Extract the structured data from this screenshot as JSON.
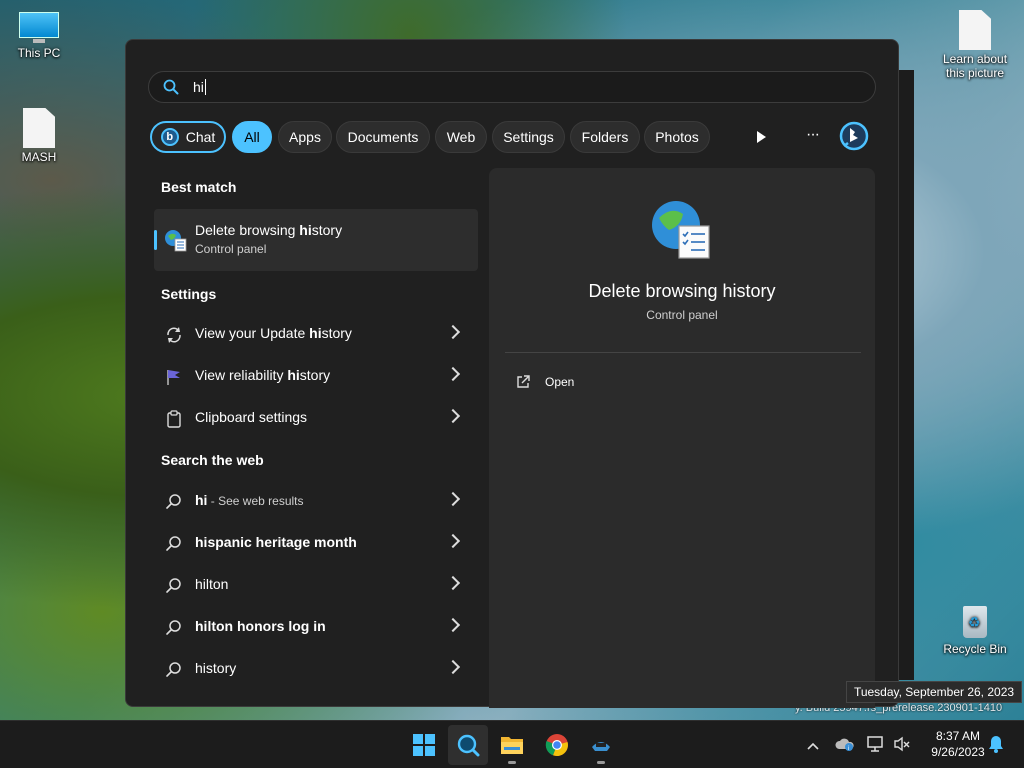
{
  "desktop": {
    "icons": [
      {
        "label": "This PC"
      },
      {
        "label": "MASH"
      },
      {
        "label": "Learn about this picture"
      },
      {
        "label": "Recycle Bin"
      }
    ],
    "build_text": "y. Build 25947.rs_prerelease.230901-1410"
  },
  "search": {
    "query": "hi",
    "filters": {
      "chat": "Chat",
      "all": "All",
      "apps": "Apps",
      "documents": "Documents",
      "web": "Web",
      "settings": "Settings",
      "folders": "Folders",
      "photos": "Photos"
    },
    "more_label": "···"
  },
  "results": {
    "best_match_title": "Best match",
    "best_match": {
      "pre": "Delete browsing ",
      "bold": "hi",
      "post": "story",
      "sub": "Control panel"
    },
    "settings_title": "Settings",
    "settings_items": [
      {
        "pre": "View your Update ",
        "bold": "hi",
        "post": "story"
      },
      {
        "pre": "View reliability ",
        "bold": "hi",
        "post": "story"
      },
      {
        "pre": "Clipboard settings",
        "bold": "",
        "post": ""
      }
    ],
    "web_title": "Search the web",
    "web_items": [
      {
        "bold": "hi",
        "rest": "",
        "sub": " - See web results"
      },
      {
        "bold": "",
        "rest": "hispanic heritage month",
        "sub": ""
      },
      {
        "bold": "",
        "rest": "hilton",
        "sub": ""
      },
      {
        "bold": "",
        "rest": "hilton honors log in",
        "sub": ""
      },
      {
        "bold": "",
        "rest": "history",
        "sub": ""
      }
    ]
  },
  "detail": {
    "title": "Delete browsing history",
    "subtitle": "Control panel",
    "open_label": "Open"
  },
  "tooltip": "Tuesday, September 26, 2023",
  "clock": {
    "time": "8:37 AM",
    "date": "9/26/2023"
  },
  "colors": {
    "accent": "#4cc2ff",
    "panel": "#202020",
    "pane": "#2b2b2b"
  }
}
